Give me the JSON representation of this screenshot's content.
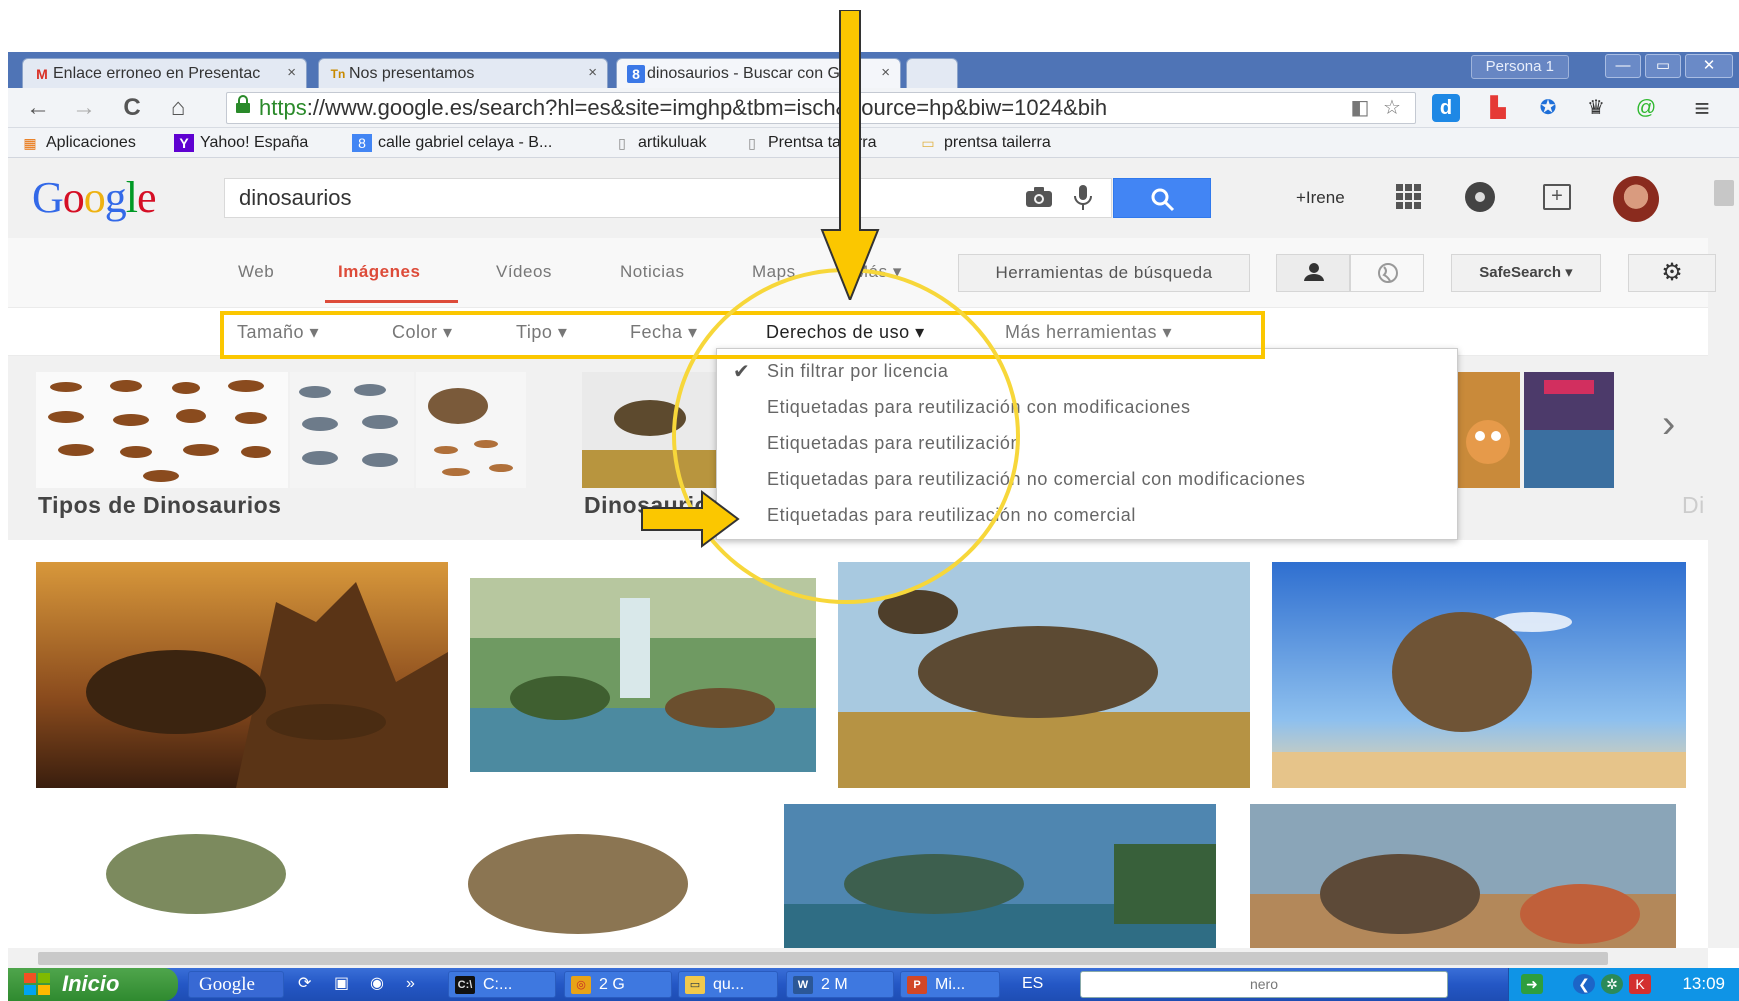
{
  "browser": {
    "tabs": [
      {
        "title": "Enlace erroneo en Presentac",
        "favicon": "gmail-icon",
        "glyph": "M",
        "color": "#d93025"
      },
      {
        "title": "Nos presentamos",
        "favicon": "tinypic-icon",
        "glyph": "Tn",
        "color": "#c88a00"
      },
      {
        "title": "dinosaurios - Buscar con Goo",
        "favicon": "google-icon",
        "glyph": "8",
        "color": "#ffffff"
      }
    ],
    "tab_close_glyph": "×",
    "persona": "Persona 1",
    "window_buttons": [
      "—",
      "▭",
      "✕"
    ],
    "url_scheme": "https",
    "url_rest": "://www.google.es/search?hl=es&site=imghp&tbm=isch&source=hp&biw=1024&bih",
    "nav_glyphs": {
      "back": "←",
      "forward": "→",
      "reload": "C",
      "home": "⌂",
      "lock": "🔒",
      "star": "☆",
      "menu": "≡"
    },
    "bookmarks": [
      {
        "label": "Aplicaciones",
        "icon": "apps-grid-icon",
        "glyph": "▦",
        "color": "#e8710a"
      },
      {
        "label": "Yahoo! España",
        "icon": "yahoo-icon",
        "glyph": "Y",
        "color": "#5f01d1"
      },
      {
        "label": "calle gabriel celaya - B...",
        "icon": "google-icon",
        "glyph": "8",
        "color": "#4285f4"
      },
      {
        "label": "artikuluak",
        "icon": "page-icon",
        "glyph": "▯",
        "color": "#888888"
      },
      {
        "label": "Prentsa tailerra",
        "icon": "page-icon",
        "glyph": "▯",
        "color": "#888888"
      },
      {
        "label": "prentsa tailerra",
        "icon": "folder-icon",
        "glyph": "▭",
        "color": "#e0b040"
      }
    ]
  },
  "google": {
    "logo": [
      "G",
      "o",
      "o",
      "g",
      "l",
      "e"
    ],
    "query": "dinosaurios",
    "user": "+Irene",
    "nav_tabs": [
      "Web",
      "Imágenes",
      "Vídeos",
      "Noticias",
      "Maps",
      "Más ▾"
    ],
    "active_tab": "Imágenes",
    "search_tools": "Herramientas de búsqueda",
    "safesearch": "SafeSearch ▾",
    "glyphs": {
      "camera": "📷",
      "mic": "🎤",
      "person": "👤",
      "globe": "◐",
      "gear": "⚙",
      "plus": "+",
      "next": "›"
    },
    "tools": [
      {
        "label": "Tamaño ▾"
      },
      {
        "label": "Color ▾"
      },
      {
        "label": "Tipo ▾"
      },
      {
        "label": "Fecha ▾"
      },
      {
        "label": "Derechos de uso ▾"
      },
      {
        "label": "Más herramientas ▾"
      }
    ],
    "rights_menu": {
      "check_glyph": "✔",
      "items": [
        "Sin filtrar por licencia",
        "Etiquetadas para reutilización con modificaciones",
        "Etiquetadas para reutilización",
        "Etiquetadas para reutilización no comercial con modificaciones",
        "Etiquetadas para reutilización no comercial"
      ],
      "selected_index": 0
    },
    "related": [
      "Tipos de Dinosaurios",
      "Dinosaurios",
      "Di"
    ]
  },
  "taskbar": {
    "start": "Inicio",
    "google_toolbar": "Google",
    "overflow": "»",
    "tasks": [
      {
        "label": "C:...",
        "icon": "cmd-icon",
        "glyph": "C:\\"
      },
      {
        "label": "2 G",
        "icon": "chrome-icon",
        "glyph": "◎"
      },
      {
        "label": "qu...",
        "icon": "folder-icon",
        "glyph": "▭"
      },
      {
        "label": "2 M",
        "icon": "word-icon",
        "glyph": "W"
      },
      {
        "label": "Mi...",
        "icon": "powerpoint-icon",
        "glyph": "P"
      }
    ],
    "lang": "ES",
    "nero": "nero",
    "clock": "13:09"
  },
  "colors": {
    "accent": "#dd4b39",
    "google_blue": "#4285f4",
    "annotation_yellow": "#fbc700"
  }
}
